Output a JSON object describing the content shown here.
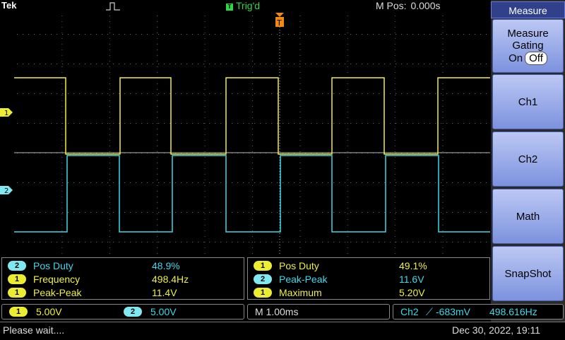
{
  "header": {
    "brand": "Tek",
    "trigger_state": "Trig'd",
    "trigger_state_icon_label": "T",
    "mpos_label": "M Pos:",
    "mpos_value": "0.000s"
  },
  "waveform": {
    "ch1_marker": "1",
    "ch2_marker": "2",
    "trigger_marker": "T",
    "ch1_color": "#f0f040",
    "ch2_color": "#40d8e8"
  },
  "sidebar": {
    "title": "Measure",
    "gating_label_1": "Measure",
    "gating_label_2": "Gating",
    "gating_on": "On",
    "gating_off": "Off",
    "btn_ch1": "Ch1",
    "btn_ch2": "Ch2",
    "btn_math": "Math",
    "btn_snapshot": "SnapShot"
  },
  "measurements_left": [
    {
      "ch": "2",
      "name": "Pos Duty",
      "value": "48.9%"
    },
    {
      "ch": "1",
      "name": "Frequency",
      "value": "498.4Hz"
    },
    {
      "ch": "1",
      "name": "Peak-Peak",
      "value": "11.4V"
    }
  ],
  "measurements_right": [
    {
      "ch": "1",
      "name": "Pos Duty",
      "value": "49.1%"
    },
    {
      "ch": "2",
      "name": "Peak-Peak",
      "value": "11.6V"
    },
    {
      "ch": "1",
      "name": "Maximum",
      "value": "5.20V"
    }
  ],
  "status": {
    "ch1_badge": "1",
    "ch1_scale": "5.00V",
    "ch2_badge": "2",
    "ch2_scale": "5.00V",
    "timebase": "M 1.00ms",
    "trigger_source": "Ch2",
    "trigger_slope": "⟋",
    "trigger_level": "-683mV",
    "trigger_freq": "498.616Hz"
  },
  "footer": {
    "message": "Please wait....",
    "datetime": "Dec 30, 2022, 19:11"
  }
}
